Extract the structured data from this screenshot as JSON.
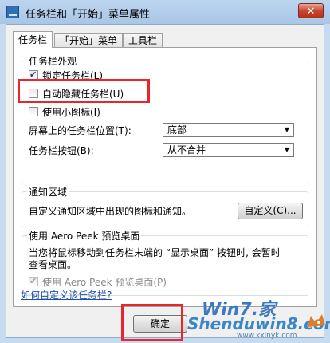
{
  "window": {
    "title": "任务栏和「开始」菜单属性",
    "close_glyph": "✕"
  },
  "tabs": [
    "任务栏",
    "「开始」菜单",
    "工具栏"
  ],
  "appearance": {
    "title": "任务栏外观",
    "lock": {
      "label": "锁定任务栏(L)",
      "checked": true
    },
    "autohide": {
      "label": "自动隐藏任务栏(U)",
      "checked": false
    },
    "small_icons": {
      "label": "使用小图标(I)",
      "checked": false
    },
    "position": {
      "label": "屏幕上的任务栏位置(T):",
      "value": "底部"
    },
    "buttons": {
      "label": "任务栏按钮(B):",
      "value": "从不合并"
    }
  },
  "notification": {
    "title": "通知区域",
    "text": "自定义通知区域中出现的图标和通知。",
    "button": "自定义(C)..."
  },
  "aero_peek": {
    "title": "使用 Aero Peek 预览桌面",
    "text_line1": "当您将鼠标移动到任务栏末端的 “显示桌面” 按钮时, 会暂时",
    "text_line2": "查看桌面。",
    "checkbox": {
      "label": "使用 Aero Peek 预览桌面(P)",
      "checked": true
    }
  },
  "help_link": "如何自定义该任务栏?",
  "ok_button": "确定",
  "watermark": {
    "logo": "Win7.家",
    "brand": "Shenduwin8.com",
    "url": "www.kxinyk.com"
  },
  "colors": {
    "highlight": "#e8262b",
    "link": "#1f4ea8"
  }
}
